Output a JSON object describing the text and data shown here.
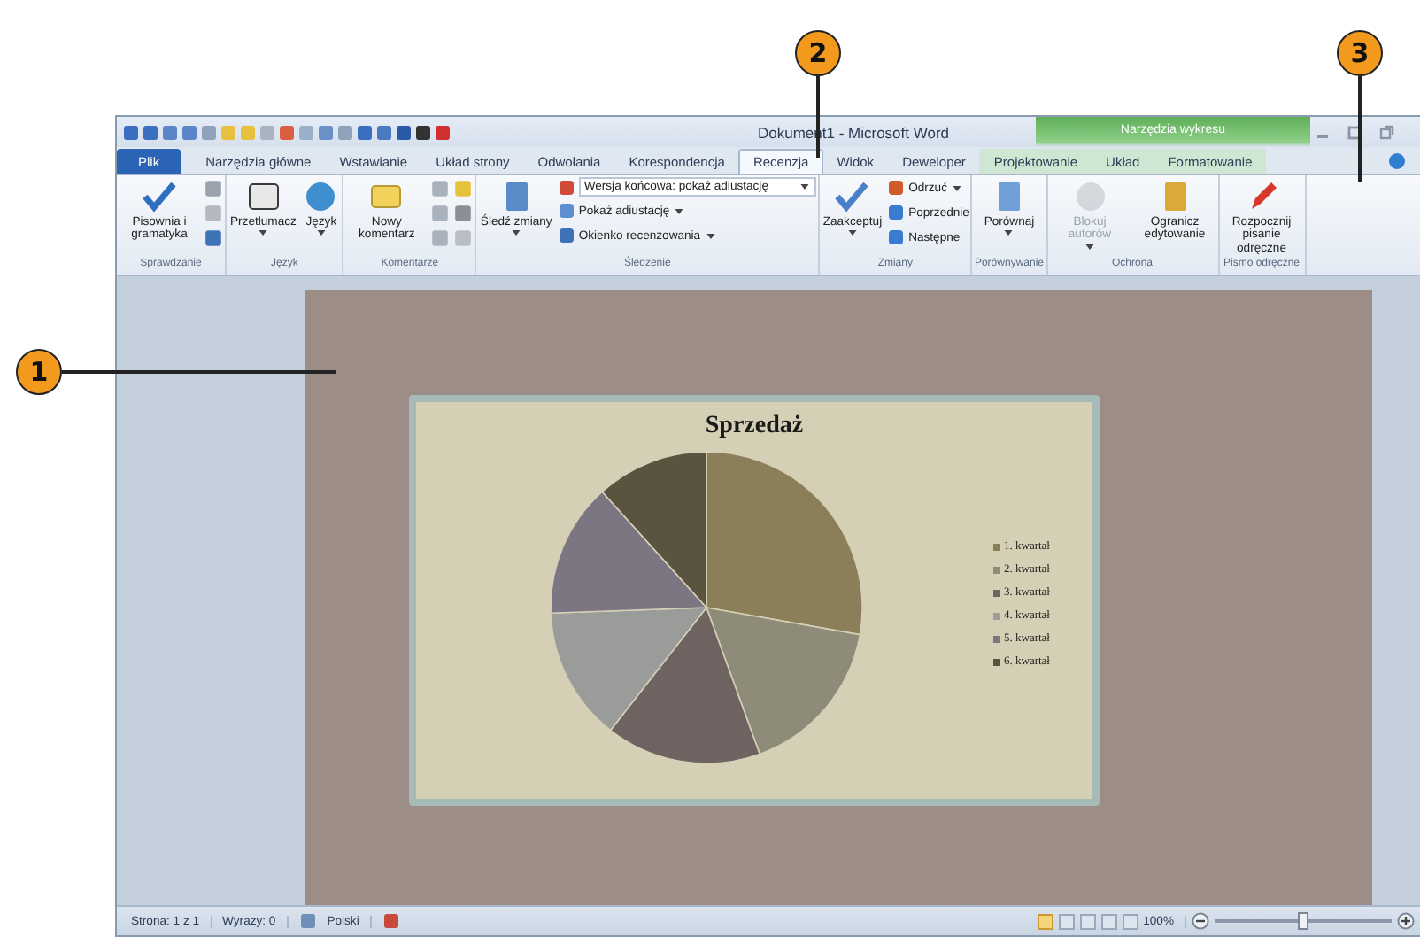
{
  "callouts": [
    {
      "label": "1"
    },
    {
      "label": "2"
    },
    {
      "label": "3"
    }
  ],
  "window": {
    "title": "Dokument1 - Microsoft Word",
    "context_group": "Narzędzia wykresu"
  },
  "tabs": [
    {
      "label": "Plik",
      "kind": "file",
      "selected": false
    },
    {
      "label": "Narzędzia główne",
      "kind": "normal",
      "selected": false
    },
    {
      "label": "Wstawianie",
      "kind": "normal",
      "selected": false
    },
    {
      "label": "Układ strony",
      "kind": "normal",
      "selected": false
    },
    {
      "label": "Odwołania",
      "kind": "normal",
      "selected": false
    },
    {
      "label": "Korespondencja",
      "kind": "normal",
      "selected": false
    },
    {
      "label": "Recenzja",
      "kind": "normal",
      "selected": true
    },
    {
      "label": "Widok",
      "kind": "normal",
      "selected": false
    },
    {
      "label": "Deweloper",
      "kind": "normal",
      "selected": false
    },
    {
      "label": "Projektowanie",
      "kind": "context",
      "selected": false
    },
    {
      "label": "Układ",
      "kind": "context",
      "selected": false
    },
    {
      "label": "Formatowanie",
      "kind": "context",
      "selected": false
    }
  ],
  "ribbon_groups": [
    {
      "name": "Sprawdzanie",
      "columns": [
        [
          {
            "kind": "large",
            "label": "Pisownia i gramatyka",
            "menu": false,
            "disabled": false
          }
        ],
        [
          {
            "kind": "icon"
          },
          {
            "kind": "icon"
          },
          {
            "kind": "icon"
          }
        ]
      ]
    },
    {
      "name": "Język",
      "columns": [
        [
          {
            "kind": "large",
            "label": "Przetłumacz",
            "menu": true,
            "disabled": false
          }
        ],
        [
          {
            "kind": "large",
            "label": "Język",
            "menu": true,
            "disabled": false
          }
        ]
      ]
    },
    {
      "name": "Komentarze",
      "columns": [
        [
          {
            "kind": "large",
            "label": "Nowy komentarz",
            "menu": false,
            "disabled": false
          }
        ],
        [
          {
            "kind": "icon"
          },
          {
            "kind": "icon"
          },
          {
            "kind": "icon"
          }
        ],
        [
          {
            "kind": "icon"
          },
          {
            "kind": "icon"
          },
          {
            "kind": "icon"
          }
        ]
      ]
    },
    {
      "name": "Śledzenie",
      "columns": [
        [
          {
            "kind": "large",
            "label": "Śledź zmiany",
            "menu": true,
            "disabled": false
          }
        ],
        [
          {
            "kind": "select",
            "label": "Wersja końcowa: pokaż adiustację"
          },
          {
            "kind": "small",
            "label": "Pokaż adiustację",
            "menu": true,
            "disabled": false
          },
          {
            "kind": "small",
            "label": "Okienko recenzowania",
            "menu": true,
            "disabled": false
          }
        ]
      ]
    },
    {
      "name": "Zmiany",
      "columns": [
        [
          {
            "kind": "large",
            "label": "Zaakceptuj",
            "menu": true,
            "disabled": false
          }
        ],
        [
          {
            "kind": "small",
            "label": "Odrzuć",
            "menu": true,
            "disabled": false
          },
          {
            "kind": "small",
            "label": "Poprzednie",
            "menu": false,
            "disabled": false
          },
          {
            "kind": "small",
            "label": "Następne",
            "menu": false,
            "disabled": false
          }
        ]
      ]
    },
    {
      "name": "Porównywanie",
      "columns": [
        [
          {
            "kind": "large",
            "label": "Porównaj",
            "menu": true,
            "disabled": false
          }
        ]
      ]
    },
    {
      "name": "Ochrona",
      "columns": [
        [
          {
            "kind": "large",
            "label": "Blokuj autorów",
            "menu": true,
            "disabled": true
          }
        ],
        [
          {
            "kind": "large",
            "label": "Ogranicz edytowanie",
            "menu": false,
            "disabled": false
          }
        ]
      ]
    },
    {
      "name": "Pismo odręczne",
      "columns": [
        [
          {
            "kind": "large",
            "label": "Rozpocznij pisanie odręczne",
            "menu": false,
            "disabled": false
          }
        ]
      ]
    }
  ],
  "chart": {
    "title": "Sprzedaż",
    "legend": [
      {
        "label": "1. kwartał",
        "color": "#8a7f58"
      },
      {
        "label": "2. kwartał",
        "color": "#8e8b79"
      },
      {
        "label": "3. kwartał",
        "color": "#6e6360"
      },
      {
        "label": "4. kwartał",
        "color": "#999c99"
      },
      {
        "label": "5. kwartał",
        "color": "#7b7682"
      },
      {
        "label": "6. kwartał",
        "color": "#59533f"
      }
    ]
  },
  "status_bar": {
    "items": [
      {
        "kind": "text",
        "label": "Strona: 1 z 1"
      },
      {
        "kind": "text",
        "label": "Wyrazy: 0"
      },
      {
        "kind": "icon"
      },
      {
        "kind": "text",
        "label": "Polski"
      },
      {
        "kind": "icon"
      }
    ],
    "views": [
      {
        "selected": true
      },
      {
        "selected": false
      },
      {
        "selected": false
      },
      {
        "selected": false
      },
      {
        "selected": false
      }
    ],
    "zoom": {
      "label": "100%",
      "level": 0.5
    }
  }
}
